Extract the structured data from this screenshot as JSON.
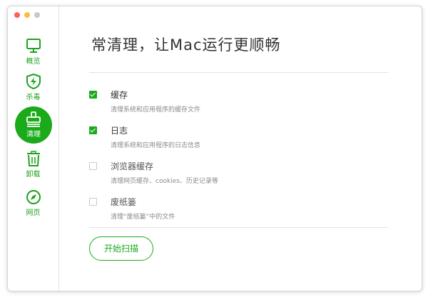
{
  "window": {
    "controls": [
      "close",
      "minimize",
      "zoom"
    ],
    "colors": {
      "close": "#fc605c",
      "minimize": "#fdbc40",
      "zoom": "#c8c8c8"
    }
  },
  "sidebar": {
    "items": [
      {
        "label": "概览",
        "icon": "monitor-icon",
        "active": false
      },
      {
        "label": "杀毒",
        "icon": "shield-lightning-icon",
        "active": false
      },
      {
        "label": "清理",
        "icon": "brush-icon",
        "active": true
      },
      {
        "label": "卸载",
        "icon": "trash-icon",
        "active": false
      },
      {
        "label": "网页",
        "icon": "compass-icon",
        "active": false
      }
    ]
  },
  "main": {
    "title": "常清理，让Mac运行更顺畅",
    "options": [
      {
        "title": "缓存",
        "description": "清理系统和应用程序的缓存文件",
        "checked": true
      },
      {
        "title": "日志",
        "description": "清理系统和应用程序的日志信息",
        "checked": true
      },
      {
        "title": "浏览器缓存",
        "description": "清理网页缓存、cookies、历史记录等",
        "checked": false
      },
      {
        "title": "废纸篓",
        "description": "清理“废纸篓”中的文件",
        "checked": false
      }
    ],
    "start_button": "开始扫描"
  },
  "colors": {
    "accent": "#1aaa1a",
    "title_text": "#333333",
    "description_text": "#8a8a8a"
  }
}
